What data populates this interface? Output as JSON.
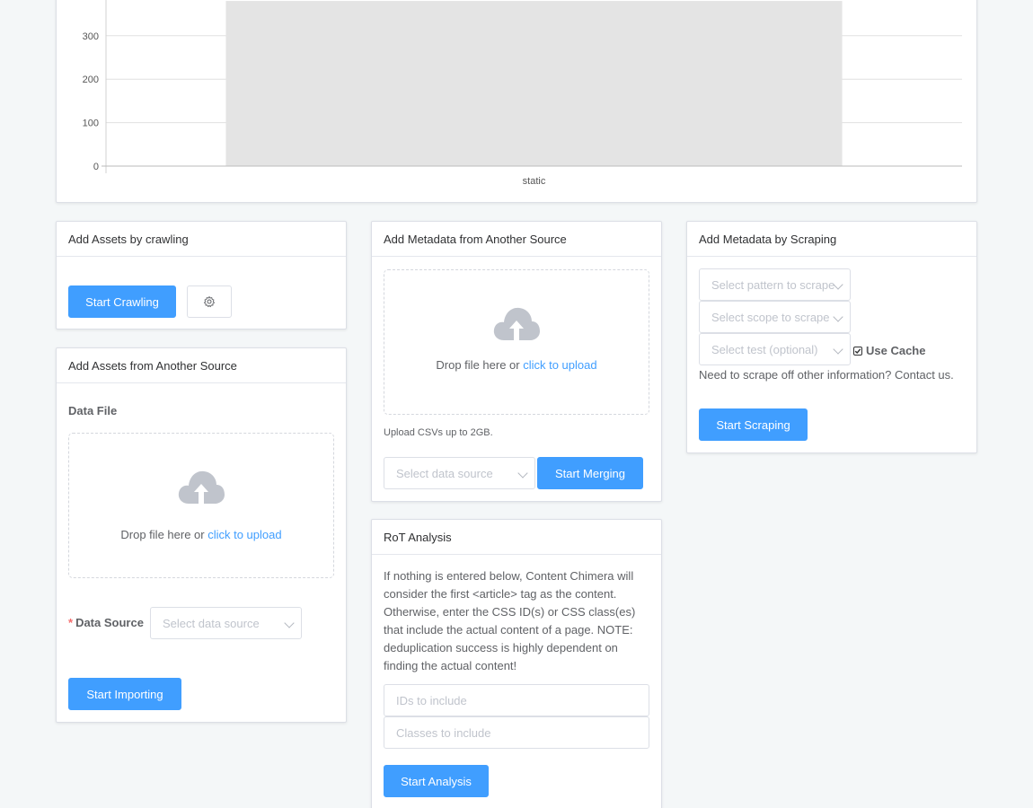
{
  "chart_data": {
    "type": "bar",
    "categories": [
      "static"
    ],
    "values": [
      380
    ],
    "yticks": [
      0,
      100,
      200,
      300
    ],
    "ylim": [
      0,
      400
    ],
    "grid": true,
    "color": "#e4e4e4"
  },
  "crawl_card": {
    "title": "Add Assets by crawling",
    "start_label": "Start Crawling",
    "settings_icon": "gear-icon"
  },
  "import_card": {
    "title": "Add Assets from Another Source",
    "data_file_label": "Data File",
    "drop_text": "Drop file here or ",
    "drop_link": "click to upload",
    "required_mark": "*",
    "data_source_label": "Data Source",
    "data_source_placeholder": "Select data source",
    "start_label": "Start Importing"
  },
  "metadata_card": {
    "title": "Add Metadata from Another Source",
    "drop_text": "Drop file here or ",
    "drop_link": "click to upload",
    "tip": "Upload CSVs up to 2GB.",
    "data_source_placeholder": "Select data source",
    "start_label": "Start Merging"
  },
  "rot_card": {
    "title": "RoT Analysis",
    "description": "If nothing is entered below, Content Chimera will consider the first <article> tag as the content. Otherwise, enter the CSS ID(s) or CSS class(es) that include the actual content of a page. NOTE: deduplication success is highly dependent on finding the actual content!",
    "ids_placeholder": "IDs to include",
    "classes_placeholder": "Classes to include",
    "start_label": "Start Analysis"
  },
  "scrape_card": {
    "title": "Add Metadata by Scraping",
    "pattern_placeholder": "Select pattern to scrape",
    "scope_placeholder": "Select scope to scrape",
    "test_placeholder": "Select test (optional)",
    "use_cache_label": "Use Cache",
    "use_cache_checked": true,
    "contact_text": "Need to scrape off other information? Contact us.",
    "start_label": "Start Scraping"
  },
  "colors": {
    "primary": "#409eff",
    "border": "#dcdfe6",
    "background": "#f4f7f8",
    "cloud": "#c0c4cc"
  }
}
